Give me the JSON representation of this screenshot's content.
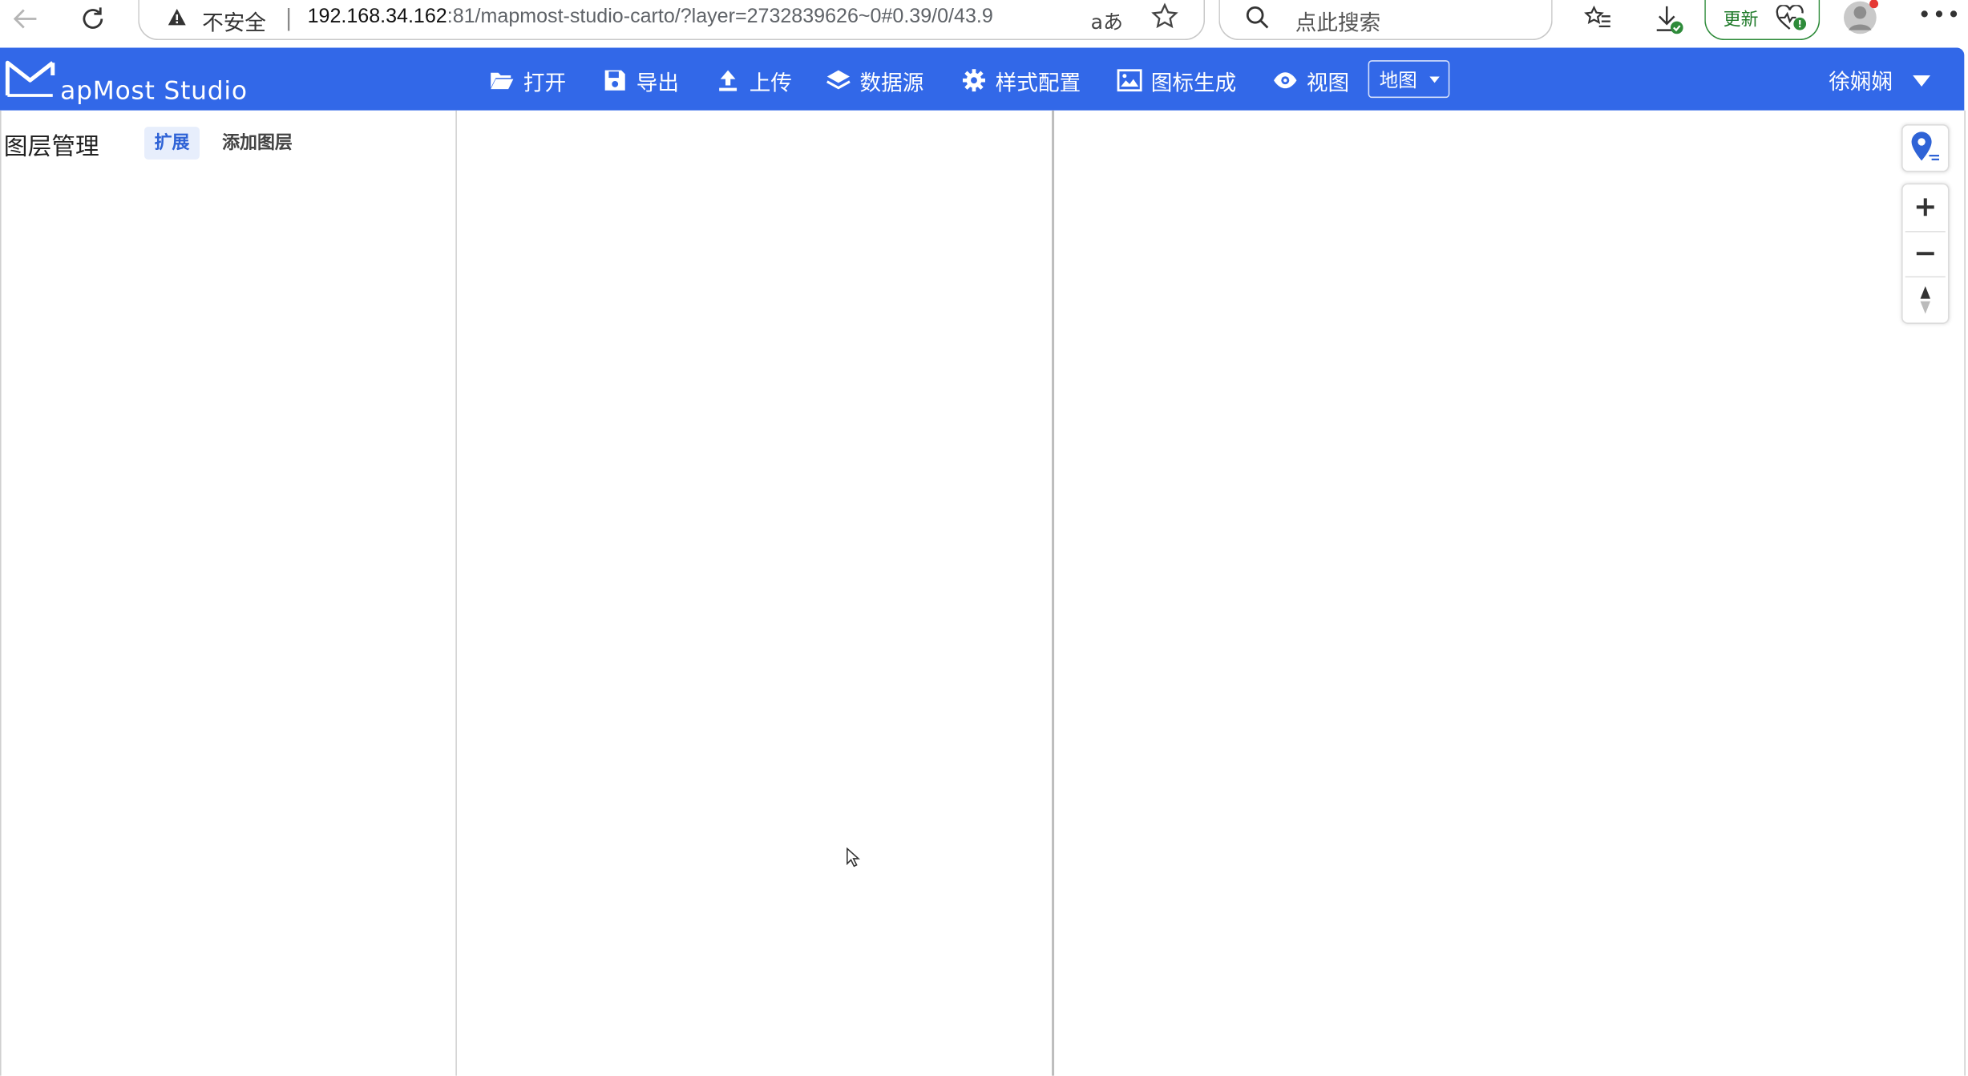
{
  "browser": {
    "address": {
      "insecure_label": "不安全",
      "url_host": "192.168.34.162",
      "url_rest": ":81/mapmost-studio-carto/?layer=2732839626~0#0.39/0/43.9",
      "read_aloud": "aあ"
    },
    "search_placeholder": "点此搜索",
    "update_label": "更新"
  },
  "app": {
    "brand": "apMost Studio",
    "nav": [
      {
        "label": "打开",
        "icon": "folder-open-icon"
      },
      {
        "label": "导出",
        "icon": "floppy-disk-icon"
      },
      {
        "label": "上传",
        "icon": "upload-icon"
      },
      {
        "label": "数据源",
        "icon": "layers-icon"
      },
      {
        "label": "样式配置",
        "icon": "gear-icon"
      },
      {
        "label": "图标生成",
        "icon": "image-icon"
      },
      {
        "label": "视图",
        "icon": "eye-icon"
      }
    ],
    "view_select": "地图",
    "user_name": "徐娴娴"
  },
  "left_panel": {
    "title": "图层管理",
    "expand_tab": "扩展",
    "add_layer_tab": "添加图层"
  },
  "map_controls": {
    "zoom_in": "+",
    "zoom_out": "−"
  },
  "colors": {
    "navbar": "#3268e8",
    "accent": "#2f63d6",
    "update_green": "#2e8b3a"
  }
}
